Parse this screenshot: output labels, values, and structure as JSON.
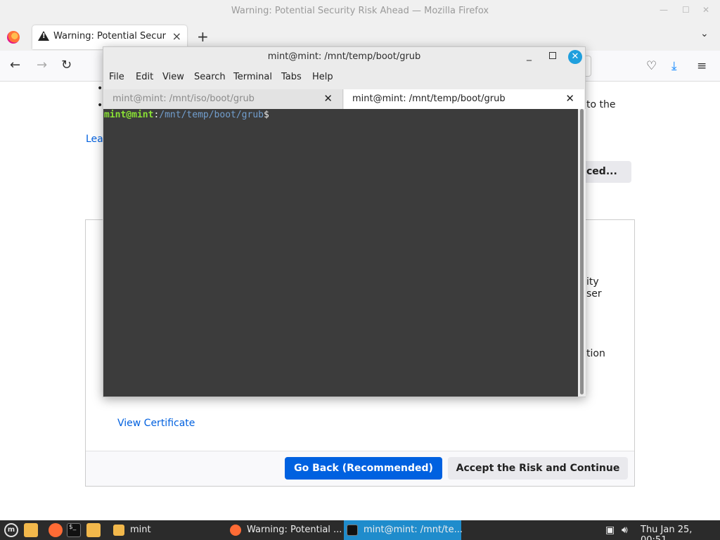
{
  "firefox": {
    "window_title": "Warning: Potential Security Risk Ahead — Mozilla Firefox",
    "tab_label": "Warning: Potential Security Risk Ahead",
    "page": {
      "fragment_to_the": "to the",
      "fragment_lea": "Lea",
      "advanced_label": "ced...",
      "fragment_ity": "ity",
      "fragment_ser": "ser",
      "fragment_tion": "tion",
      "view_certificate": "View Certificate",
      "go_back_label": "Go Back (Recommended)",
      "accept_label": "Accept the Risk and Continue"
    }
  },
  "terminal": {
    "title": "mint@mint: /mnt/temp/boot/grub",
    "menu": [
      "File",
      "Edit",
      "View",
      "Search",
      "Terminal",
      "Tabs",
      "Help"
    ],
    "tabs": [
      {
        "label": "mint@mint: /mnt/iso/boot/grub",
        "active": false
      },
      {
        "label": "mint@mint: /mnt/temp/boot/grub",
        "active": true
      }
    ],
    "prompt": {
      "user_host": "mint@mint",
      "colon": ":",
      "path": "/mnt/temp/boot/grub",
      "symbol": "$"
    }
  },
  "taskbar": {
    "tasks": [
      {
        "label": "mint",
        "active": false
      },
      {
        "label": "Warning: Potential ...",
        "active": false
      },
      {
        "label": "mint@mint: /mnt/te...",
        "active": true
      }
    ],
    "clock": "Thu Jan 25, 00:51"
  },
  "colors": {
    "accent_blue": "#0061e0",
    "terminal_bg": "#3c3c3c",
    "prompt_user": "#8ae234",
    "prompt_path": "#729fcf",
    "taskbar_active": "#1f8ccc"
  }
}
